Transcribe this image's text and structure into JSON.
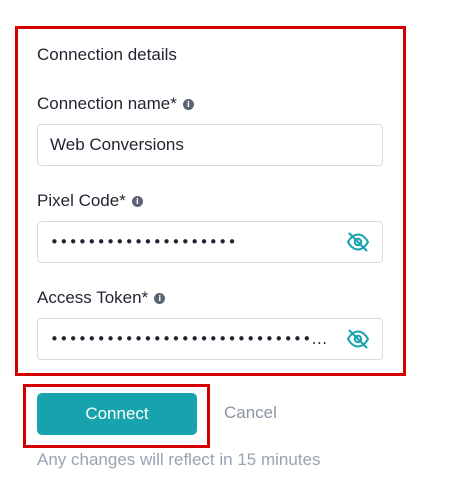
{
  "section": {
    "title": "Connection details"
  },
  "fields": {
    "connection_name": {
      "label": "Connection name*",
      "value": "Web Conversions"
    },
    "pixel_code": {
      "label": "Pixel Code*",
      "value": "••••••••••••••••••••"
    },
    "access_token": {
      "label": "Access Token*",
      "value": "••••••••••••••••••••••••••••..."
    }
  },
  "actions": {
    "connect_label": "Connect",
    "cancel_label": "Cancel"
  },
  "footnote": "Any changes will reflect in 15 minutes",
  "colors": {
    "accent": "#17a3ad",
    "highlight": "#d40000",
    "muted_text": "#9aa3b2"
  },
  "icons": {
    "info": "info-icon",
    "toggle_visibility": "eye-off-icon"
  }
}
